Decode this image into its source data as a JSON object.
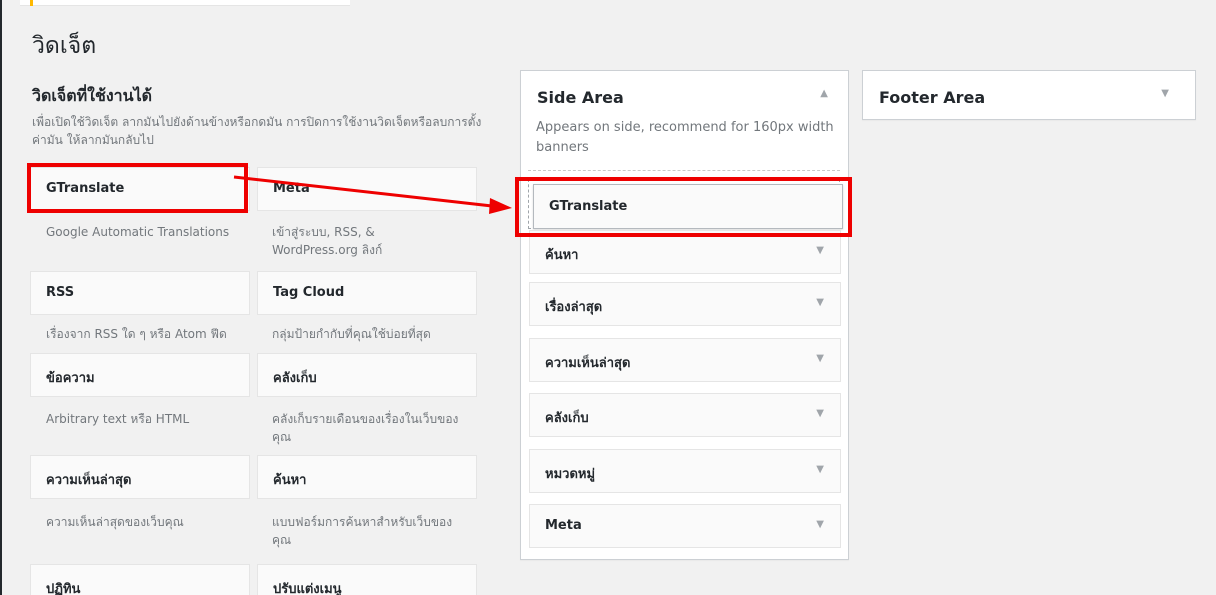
{
  "page": {
    "title": "วิดเจ็ต"
  },
  "available": {
    "title": "วิดเจ็ตที่ใช้งานได้",
    "description": "เพื่อเปิดใช้วิดเจ็ต ลากมันไปยังด้านข้างหรือกดมัน การปิดการใช้งานวิดเจ็ตหรือลบการตั้งค่ามัน ให้ลากมันกลับไป",
    "widgets": [
      {
        "title": "GTranslate",
        "desc": "Google Automatic Translations"
      },
      {
        "title": "Meta",
        "desc": "เข้าสู่ระบบ, RSS, & WordPress.org ลิงก์"
      },
      {
        "title": "RSS",
        "desc": "เรื่องจาก RSS ใด ๆ หรือ Atom ฟีด"
      },
      {
        "title": "Tag Cloud",
        "desc": "กลุ่มป้ายกำกับที่คุณใช้บ่อยที่สุด"
      },
      {
        "title": "ข้อความ",
        "desc": "Arbitrary text หรือ HTML"
      },
      {
        "title": "คลังเก็บ",
        "desc": "คลังเก็บรายเดือนของเรื่องในเว็บของคุณ"
      },
      {
        "title": "ความเห็นล่าสุด",
        "desc": "ความเห็นล่าสุดของเว็บคุณ"
      },
      {
        "title": "ค้นหา",
        "desc": "แบบฟอร์มการค้นหาสำหรับเว็บของคุณ"
      },
      {
        "title": "ปฏิทิน",
        "desc": ""
      },
      {
        "title": "ปรับแต่งเมนู",
        "desc": ""
      }
    ]
  },
  "side_area": {
    "title": "Side Area",
    "description": "Appears on side, recommend for 160px width banners",
    "dragging_widget": "GTranslate",
    "widgets": [
      "ค้นหา",
      "เรื่องล่าสุด",
      "ความเห็นล่าสุด",
      "คลังเก็บ",
      "หมวดหมู่",
      "Meta"
    ]
  },
  "footer_area": {
    "title": "Footer Area"
  },
  "icons": {
    "collapse": "triangle-up-icon",
    "expand": "triangle-down-icon"
  },
  "colors": {
    "annotation": "#ee0000",
    "notice_accent": "#ffb900"
  }
}
